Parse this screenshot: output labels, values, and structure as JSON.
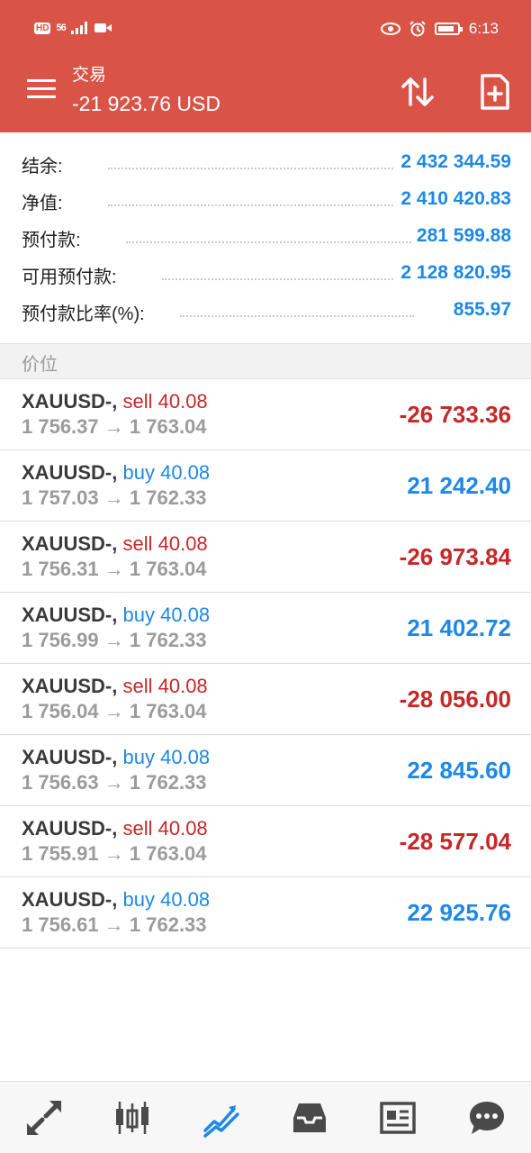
{
  "status_bar": {
    "left_badge": "HD",
    "signal_label": "56",
    "time": "6:13",
    "battery_level": 0.85
  },
  "header": {
    "title": "交易",
    "subtitle": "-21 923.76 USD",
    "icons": [
      "menu-icon",
      "sort-icon",
      "new-order-icon"
    ]
  },
  "summary": {
    "balance": {
      "label": "结余:",
      "value": "2 432 344.59"
    },
    "equity": {
      "label": "净值:",
      "value": "2 410 420.83"
    },
    "margin": {
      "label": "预付款:",
      "value": "281 599.88"
    },
    "free_margin": {
      "label": "可用预付款:",
      "value": "2 128 820.95"
    },
    "margin_level": {
      "label": "预付款比率(%):",
      "value": "855.97"
    }
  },
  "section": {
    "title": "价位"
  },
  "positions": [
    {
      "symbol": "XAUUSD-,",
      "type": "sell",
      "volume": "40.08",
      "open_price": "1 756.37",
      "arrow": "→",
      "current_price": "1 763.04",
      "profit": "-26 733.36"
    },
    {
      "symbol": "XAUUSD-,",
      "type": "buy",
      "volume": "40.08",
      "open_price": "1 757.03",
      "arrow": "→",
      "current_price": "1 762.33",
      "profit": "21 242.40"
    },
    {
      "symbol": "XAUUSD-,",
      "type": "sell",
      "volume": "40.08",
      "open_price": "1 756.31",
      "arrow": "→",
      "current_price": "1 763.04",
      "profit": "-26 973.84"
    },
    {
      "symbol": "XAUUSD-,",
      "type": "buy",
      "volume": "40.08",
      "open_price": "1 756.99",
      "arrow": "→",
      "current_price": "1 762.33",
      "profit": "21 402.72"
    },
    {
      "symbol": "XAUUSD-,",
      "type": "sell",
      "volume": "40.08",
      "open_price": "1 756.04",
      "arrow": "→",
      "current_price": "1 763.04",
      "profit": "-28 056.00"
    },
    {
      "symbol": "XAUUSD-,",
      "type": "buy",
      "volume": "40.08",
      "open_price": "1 756.63",
      "arrow": "→",
      "current_price": "1 762.33",
      "profit": "22 845.60"
    },
    {
      "symbol": "XAUUSD-,",
      "type": "sell",
      "volume": "40.08",
      "open_price": "1 755.91",
      "arrow": "→",
      "current_price": "1 763.04",
      "profit": "-28 577.04"
    },
    {
      "symbol": "XAUUSD-,",
      "type": "buy",
      "volume": "40.08",
      "open_price": "1 756.61",
      "arrow": "→",
      "current_price": "1 762.33",
      "profit": "22 925.76"
    }
  ],
  "bottom_nav": [
    {
      "icon": "quotes-icon",
      "active": false
    },
    {
      "icon": "chart-icon",
      "active": false
    },
    {
      "icon": "trade-icon",
      "active": true
    },
    {
      "icon": "history-icon",
      "active": false
    },
    {
      "icon": "news-icon",
      "active": false
    },
    {
      "icon": "chat-icon",
      "active": false
    }
  ],
  "colors": {
    "header_bg": "#d95447",
    "loss": "#c62828",
    "profit": "#1e88e5",
    "nav_icon": "#4a4a4a",
    "nav_active": "#1e88e5"
  }
}
